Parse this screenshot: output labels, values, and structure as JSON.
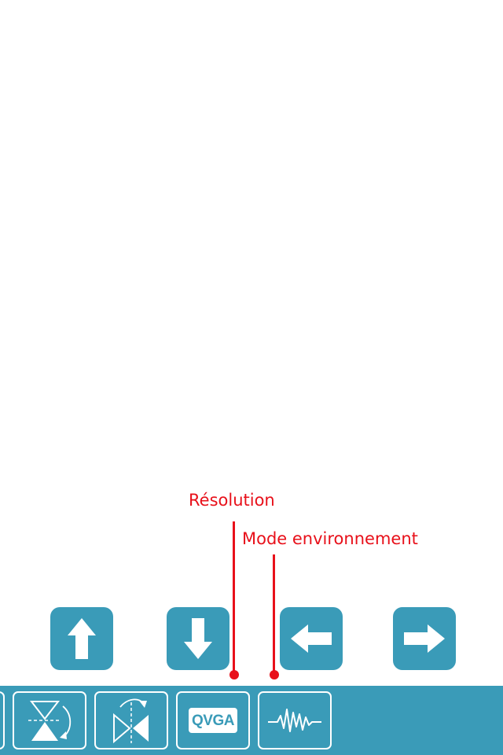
{
  "annotations": {
    "resolution_label": "Résolution",
    "environment_label": "Mode environnement"
  },
  "arrows": [
    {
      "name": "up-arrow-icon"
    },
    {
      "name": "down-arrow-icon"
    },
    {
      "name": "left-arrow-icon"
    },
    {
      "name": "right-arrow-icon"
    }
  ],
  "toolbar": {
    "buttons": [
      {
        "name": "partial-button"
      },
      {
        "name": "flip-vertical-icon"
      },
      {
        "name": "mirror-horizontal-icon"
      },
      {
        "name": "resolution-button",
        "label": "QVGA"
      },
      {
        "name": "environment-mode-icon"
      }
    ]
  },
  "colors": {
    "accent": "#3a9bb8",
    "annotation": "#e8101a",
    "icon": "#ffffff"
  }
}
